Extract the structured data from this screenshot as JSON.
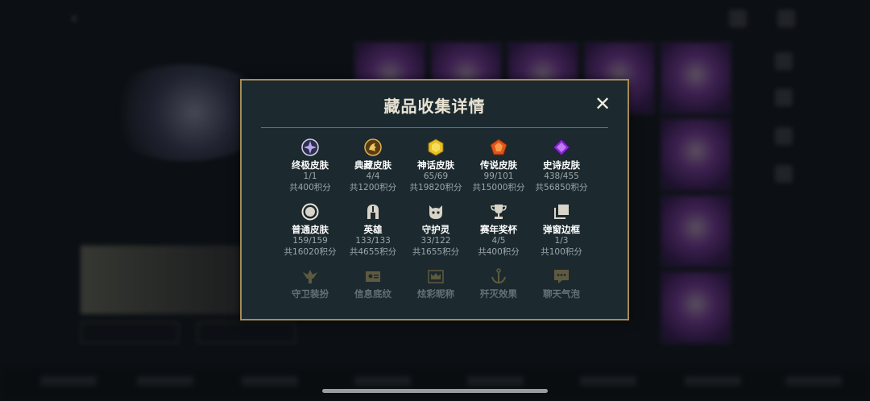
{
  "modal": {
    "title": "藏品收集详情",
    "close_label": "✕",
    "rows": [
      [
        {
          "name": "终极皮肤",
          "count": "1/1",
          "points": "共400积分",
          "icon": "ultimate-gem-icon"
        },
        {
          "name": "典藏皮肤",
          "count": "4/4",
          "points": "共1200积分",
          "icon": "dragon-medallion-icon"
        },
        {
          "name": "神话皮肤",
          "count": "65/69",
          "points": "共19820积分",
          "icon": "gold-hexagon-gem-icon"
        },
        {
          "name": "传说皮肤",
          "count": "99/101",
          "points": "共15000积分",
          "icon": "orange-pentagon-gem-icon"
        },
        {
          "name": "史诗皮肤",
          "count": "438/455",
          "points": "共56850积分",
          "icon": "purple-diamond-gem-icon"
        }
      ],
      [
        {
          "name": "普通皮肤",
          "count": "159/159",
          "points": "共16020积分",
          "icon": "circle-icon"
        },
        {
          "name": "英雄",
          "count": "133/133",
          "points": "共4655积分",
          "icon": "helmet-icon"
        },
        {
          "name": "守护灵",
          "count": "33/122",
          "points": "共1655积分",
          "icon": "guardian-creature-icon"
        },
        {
          "name": "赛年奖杯",
          "count": "4/5",
          "points": "共400积分",
          "icon": "trophy-icon"
        },
        {
          "name": "弹窗边框",
          "count": "1/3",
          "points": "共100积分",
          "icon": "stacked-frames-icon"
        }
      ],
      [
        {
          "name": "守卫装扮",
          "icon": "ward-icon"
        },
        {
          "name": "信息底纹",
          "icon": "card-pattern-icon"
        },
        {
          "name": "炫彩昵称",
          "icon": "crown-icon"
        },
        {
          "name": "歼灭效果",
          "icon": "anchor-icon"
        },
        {
          "name": "聊天气泡",
          "icon": "chat-bubble-icon"
        }
      ]
    ]
  },
  "colors": {
    "modal_bg": "#1c2a2f",
    "border_gold": "#a58b57",
    "icon_gold": "#c9a95a"
  }
}
